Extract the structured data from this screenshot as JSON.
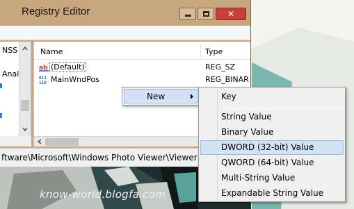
{
  "window": {
    "title": "Registry Editor",
    "title_color": "#c9a77e",
    "controls": {
      "minimize": "minimize-icon",
      "maximize": "maximize-icon",
      "close": "close-icon"
    },
    "close_glyph": "✕"
  },
  "tree": {
    "items": [
      "NSS",
      "Anal"
    ]
  },
  "list": {
    "columns": {
      "name": "Name",
      "type": "Type"
    },
    "rows": [
      {
        "name": "(Default)",
        "type": "REG_SZ",
        "icon": "string-value-icon"
      },
      {
        "name": "MainWndPos",
        "type": "REG_BINAR",
        "icon": "binary-value-icon"
      }
    ]
  },
  "status_bar": {
    "path": "ftware\\Microsoft\\Windows Photo Viewer\\Viewer"
  },
  "context_menu": {
    "new_label": "New"
  },
  "new_submenu": {
    "items": [
      "Key",
      "String Value",
      "Binary Value",
      "DWORD (32-bit) Value",
      "QWORD (64-bit) Value",
      "Multi-String Value",
      "Expandable String Value"
    ],
    "highlighted": "DWORD (32-bit) Value",
    "highlight_color": "#d3e1f5"
  },
  "watermark": "know-world.blogfa.com"
}
